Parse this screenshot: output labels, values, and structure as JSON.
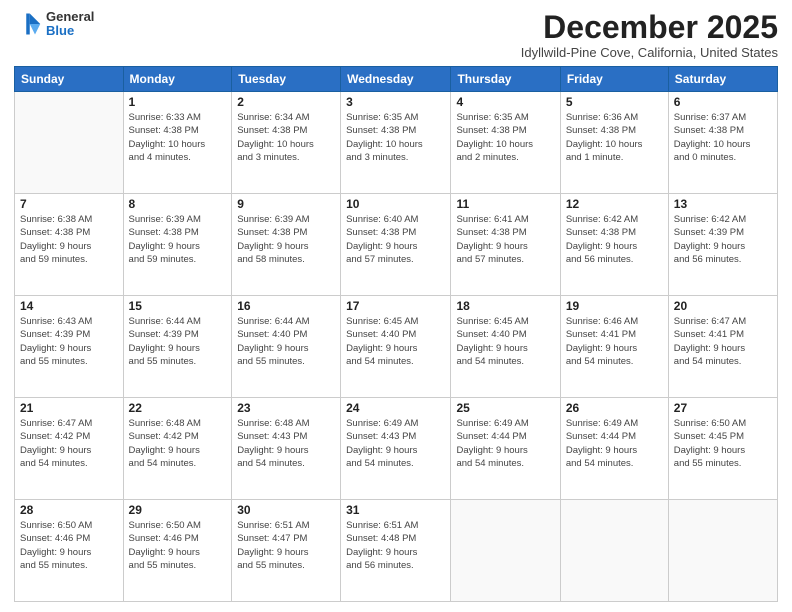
{
  "logo": {
    "general": "General",
    "blue": "Blue"
  },
  "title": "December 2025",
  "location": "Idyllwild-Pine Cove, California, United States",
  "headers": [
    "Sunday",
    "Monday",
    "Tuesday",
    "Wednesday",
    "Thursday",
    "Friday",
    "Saturday"
  ],
  "weeks": [
    [
      {
        "day": "",
        "detail": ""
      },
      {
        "day": "1",
        "detail": "Sunrise: 6:33 AM\nSunset: 4:38 PM\nDaylight: 10 hours\nand 4 minutes."
      },
      {
        "day": "2",
        "detail": "Sunrise: 6:34 AM\nSunset: 4:38 PM\nDaylight: 10 hours\nand 3 minutes."
      },
      {
        "day": "3",
        "detail": "Sunrise: 6:35 AM\nSunset: 4:38 PM\nDaylight: 10 hours\nand 3 minutes."
      },
      {
        "day": "4",
        "detail": "Sunrise: 6:35 AM\nSunset: 4:38 PM\nDaylight: 10 hours\nand 2 minutes."
      },
      {
        "day": "5",
        "detail": "Sunrise: 6:36 AM\nSunset: 4:38 PM\nDaylight: 10 hours\nand 1 minute."
      },
      {
        "day": "6",
        "detail": "Sunrise: 6:37 AM\nSunset: 4:38 PM\nDaylight: 10 hours\nand 0 minutes."
      }
    ],
    [
      {
        "day": "7",
        "detail": "Sunrise: 6:38 AM\nSunset: 4:38 PM\nDaylight: 9 hours\nand 59 minutes."
      },
      {
        "day": "8",
        "detail": "Sunrise: 6:39 AM\nSunset: 4:38 PM\nDaylight: 9 hours\nand 59 minutes."
      },
      {
        "day": "9",
        "detail": "Sunrise: 6:39 AM\nSunset: 4:38 PM\nDaylight: 9 hours\nand 58 minutes."
      },
      {
        "day": "10",
        "detail": "Sunrise: 6:40 AM\nSunset: 4:38 PM\nDaylight: 9 hours\nand 57 minutes."
      },
      {
        "day": "11",
        "detail": "Sunrise: 6:41 AM\nSunset: 4:38 PM\nDaylight: 9 hours\nand 57 minutes."
      },
      {
        "day": "12",
        "detail": "Sunrise: 6:42 AM\nSunset: 4:38 PM\nDaylight: 9 hours\nand 56 minutes."
      },
      {
        "day": "13",
        "detail": "Sunrise: 6:42 AM\nSunset: 4:39 PM\nDaylight: 9 hours\nand 56 minutes."
      }
    ],
    [
      {
        "day": "14",
        "detail": "Sunrise: 6:43 AM\nSunset: 4:39 PM\nDaylight: 9 hours\nand 55 minutes."
      },
      {
        "day": "15",
        "detail": "Sunrise: 6:44 AM\nSunset: 4:39 PM\nDaylight: 9 hours\nand 55 minutes."
      },
      {
        "day": "16",
        "detail": "Sunrise: 6:44 AM\nSunset: 4:40 PM\nDaylight: 9 hours\nand 55 minutes."
      },
      {
        "day": "17",
        "detail": "Sunrise: 6:45 AM\nSunset: 4:40 PM\nDaylight: 9 hours\nand 54 minutes."
      },
      {
        "day": "18",
        "detail": "Sunrise: 6:45 AM\nSunset: 4:40 PM\nDaylight: 9 hours\nand 54 minutes."
      },
      {
        "day": "19",
        "detail": "Sunrise: 6:46 AM\nSunset: 4:41 PM\nDaylight: 9 hours\nand 54 minutes."
      },
      {
        "day": "20",
        "detail": "Sunrise: 6:47 AM\nSunset: 4:41 PM\nDaylight: 9 hours\nand 54 minutes."
      }
    ],
    [
      {
        "day": "21",
        "detail": "Sunrise: 6:47 AM\nSunset: 4:42 PM\nDaylight: 9 hours\nand 54 minutes."
      },
      {
        "day": "22",
        "detail": "Sunrise: 6:48 AM\nSunset: 4:42 PM\nDaylight: 9 hours\nand 54 minutes."
      },
      {
        "day": "23",
        "detail": "Sunrise: 6:48 AM\nSunset: 4:43 PM\nDaylight: 9 hours\nand 54 minutes."
      },
      {
        "day": "24",
        "detail": "Sunrise: 6:49 AM\nSunset: 4:43 PM\nDaylight: 9 hours\nand 54 minutes."
      },
      {
        "day": "25",
        "detail": "Sunrise: 6:49 AM\nSunset: 4:44 PM\nDaylight: 9 hours\nand 54 minutes."
      },
      {
        "day": "26",
        "detail": "Sunrise: 6:49 AM\nSunset: 4:44 PM\nDaylight: 9 hours\nand 54 minutes."
      },
      {
        "day": "27",
        "detail": "Sunrise: 6:50 AM\nSunset: 4:45 PM\nDaylight: 9 hours\nand 55 minutes."
      }
    ],
    [
      {
        "day": "28",
        "detail": "Sunrise: 6:50 AM\nSunset: 4:46 PM\nDaylight: 9 hours\nand 55 minutes."
      },
      {
        "day": "29",
        "detail": "Sunrise: 6:50 AM\nSunset: 4:46 PM\nDaylight: 9 hours\nand 55 minutes."
      },
      {
        "day": "30",
        "detail": "Sunrise: 6:51 AM\nSunset: 4:47 PM\nDaylight: 9 hours\nand 55 minutes."
      },
      {
        "day": "31",
        "detail": "Sunrise: 6:51 AM\nSunset: 4:48 PM\nDaylight: 9 hours\nand 56 minutes."
      },
      {
        "day": "",
        "detail": ""
      },
      {
        "day": "",
        "detail": ""
      },
      {
        "day": "",
        "detail": ""
      }
    ]
  ]
}
